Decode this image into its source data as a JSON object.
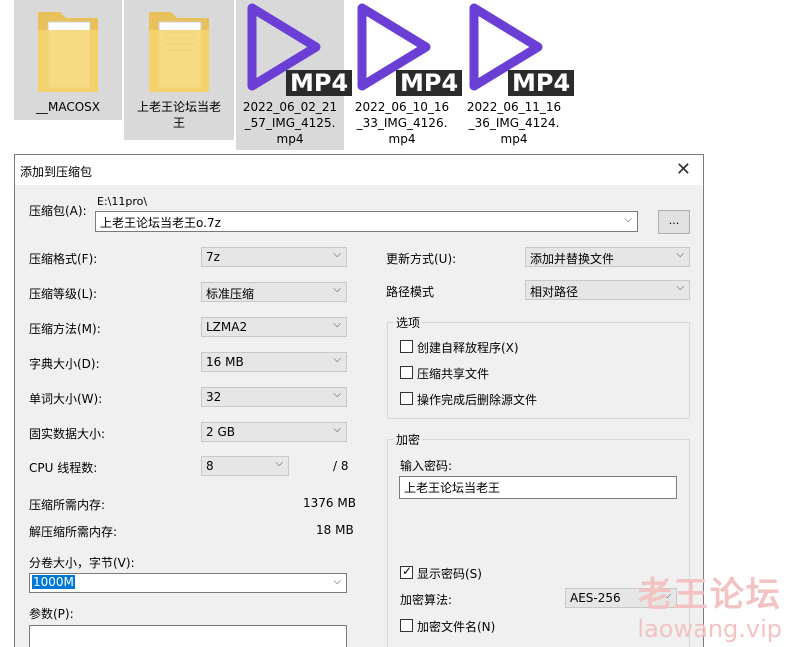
{
  "files": [
    {
      "name": "__MACOSX",
      "type": "folder"
    },
    {
      "name": "上老王论坛当老王",
      "type": "folder"
    },
    {
      "name": "2022_06_02_21_57_IMG_4125.mp4",
      "type": "video",
      "badge": "MP4",
      "line1": "2022_06_02_21",
      "line2": "_57_IMG_4125.",
      "line3": "mp4"
    },
    {
      "name": "2022_06_10_16_33_IMG_4126.mp4",
      "type": "video",
      "badge": "MP4",
      "line1": "2022_06_10_16",
      "line2": "_33_IMG_4126.",
      "line3": "mp4"
    },
    {
      "name": "2022_06_11_16_36_IMG_4124.mp4",
      "type": "video",
      "badge": "MP4",
      "line1": "2022_06_11_16",
      "line2": "_36_IMG_4124.",
      "line3": "mp4"
    }
  ],
  "folder2_line1": "上老王论坛当老",
  "folder2_line2": "王",
  "dialog": {
    "title": "添加到压缩包",
    "close": "✕",
    "archive_label": "压缩包(A):",
    "archive_path": "E:\\11pro\\",
    "archive_name": "上老王论坛当老王o.7z",
    "browse": "...",
    "format_label": "压缩格式(F):",
    "format_value": "7z",
    "level_label": "压缩等级(L):",
    "level_value": "标准压缩",
    "method_label": "压缩方法(M):",
    "method_value": "LZMA2",
    "dict_label": "字典大小(D):",
    "dict_value": "16 MB",
    "word_label": "单词大小(W):",
    "word_value": "32",
    "solid_label": "固实数据大小:",
    "solid_value": "2 GB",
    "cpu_label": "CPU 线程数:",
    "cpu_value": "8",
    "cpu_total": "/ 8",
    "mem_comp_label": "压缩所需内存:",
    "mem_comp_value": "1376 MB",
    "mem_decomp_label": "解压缩所需内存:",
    "mem_decomp_value": "18 MB",
    "split_label": "分卷大小，字节(V):",
    "split_value": "1000M",
    "params_label": "参数(P):",
    "update_label": "更新方式(U):",
    "update_value": "添加并替换文件",
    "pathmode_label": "路径模式",
    "pathmode_value": "相对路径",
    "options_title": "选项",
    "opt_sfx": "创建自释放程序(X)",
    "opt_shared": "压缩共享文件",
    "opt_delete": "操作完成后删除源文件",
    "encrypt_title": "加密",
    "password_label": "输入密码:",
    "password_value": "上老王论坛当老王",
    "show_password": "显示密码(S)",
    "enc_method_label": "加密算法:",
    "enc_method_value": "AES-256",
    "encrypt_names": "加密文件名(N)"
  },
  "watermark": {
    "line1": "老王论坛",
    "line2": "laowang.vip"
  },
  "colors": {
    "play_icon": "#6b3fd6",
    "selection": "#0078d7"
  }
}
